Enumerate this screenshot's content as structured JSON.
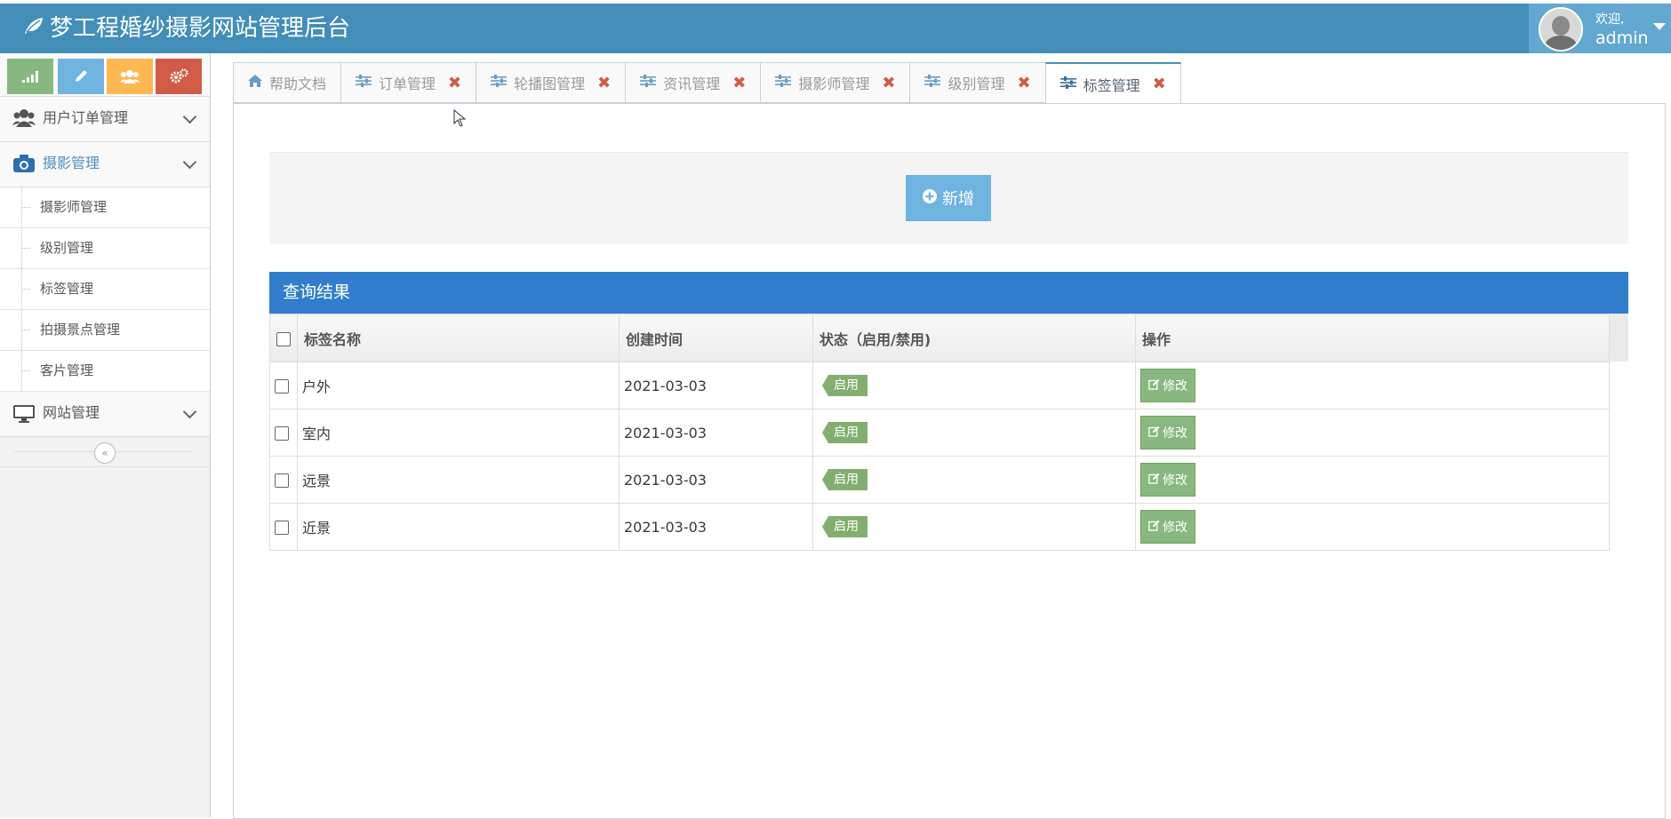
{
  "app": {
    "title": "梦工程婚纱摄影网站管理后台"
  },
  "user": {
    "welcome": "欢迎,",
    "name": "admin"
  },
  "sidebar": {
    "shortcuts": [
      {
        "name": "stats-icon",
        "color": "#87b87f"
      },
      {
        "name": "pencil-icon",
        "color": "#6fb3e0"
      },
      {
        "name": "users-icon",
        "color": "#ffb752"
      },
      {
        "name": "cogs-icon",
        "color": "#d15b47"
      }
    ],
    "menu": [
      {
        "label": "用户订单管理",
        "icon": "users-icon",
        "open": false
      },
      {
        "label": "摄影管理",
        "icon": "camera-icon",
        "open": true,
        "children": [
          "摄影师管理",
          "级别管理",
          "标签管理",
          "拍摄景点管理",
          "客片管理"
        ]
      },
      {
        "label": "网站管理",
        "icon": "desktop-icon",
        "open": false
      }
    ]
  },
  "tabs": [
    {
      "label": "帮助文档",
      "icon": "home-icon",
      "closable": false
    },
    {
      "label": "订单管理",
      "icon": "sliders-icon",
      "closable": true
    },
    {
      "label": "轮播图管理",
      "icon": "sliders-icon",
      "closable": true
    },
    {
      "label": "资讯管理",
      "icon": "sliders-icon",
      "closable": true
    },
    {
      "label": "摄影师管理",
      "icon": "sliders-icon",
      "closable": true
    },
    {
      "label": "级别管理",
      "icon": "sliders-icon",
      "closable": true
    },
    {
      "label": "标签管理",
      "icon": "sliders-icon",
      "closable": true,
      "active": true
    }
  ],
  "toolbar": {
    "add_label": "新增"
  },
  "results": {
    "title": "查询结果",
    "columns": [
      "标签名称",
      "创建时间",
      "状态（启用/禁用)",
      "操作"
    ],
    "rows": [
      {
        "name": "户外",
        "created": "2021-03-03",
        "status": "启用",
        "action": "修改"
      },
      {
        "name": "室内",
        "created": "2021-03-03",
        "status": "启用",
        "action": "修改"
      },
      {
        "name": "远景",
        "created": "2021-03-03",
        "status": "启用",
        "action": "修改"
      },
      {
        "name": "近景",
        "created": "2021-03-03",
        "status": "启用",
        "action": "修改"
      }
    ]
  },
  "colors": {
    "header": "#438eb9",
    "accent": "#307ecc",
    "success": "#87b87f",
    "danger": "#d15b47"
  }
}
